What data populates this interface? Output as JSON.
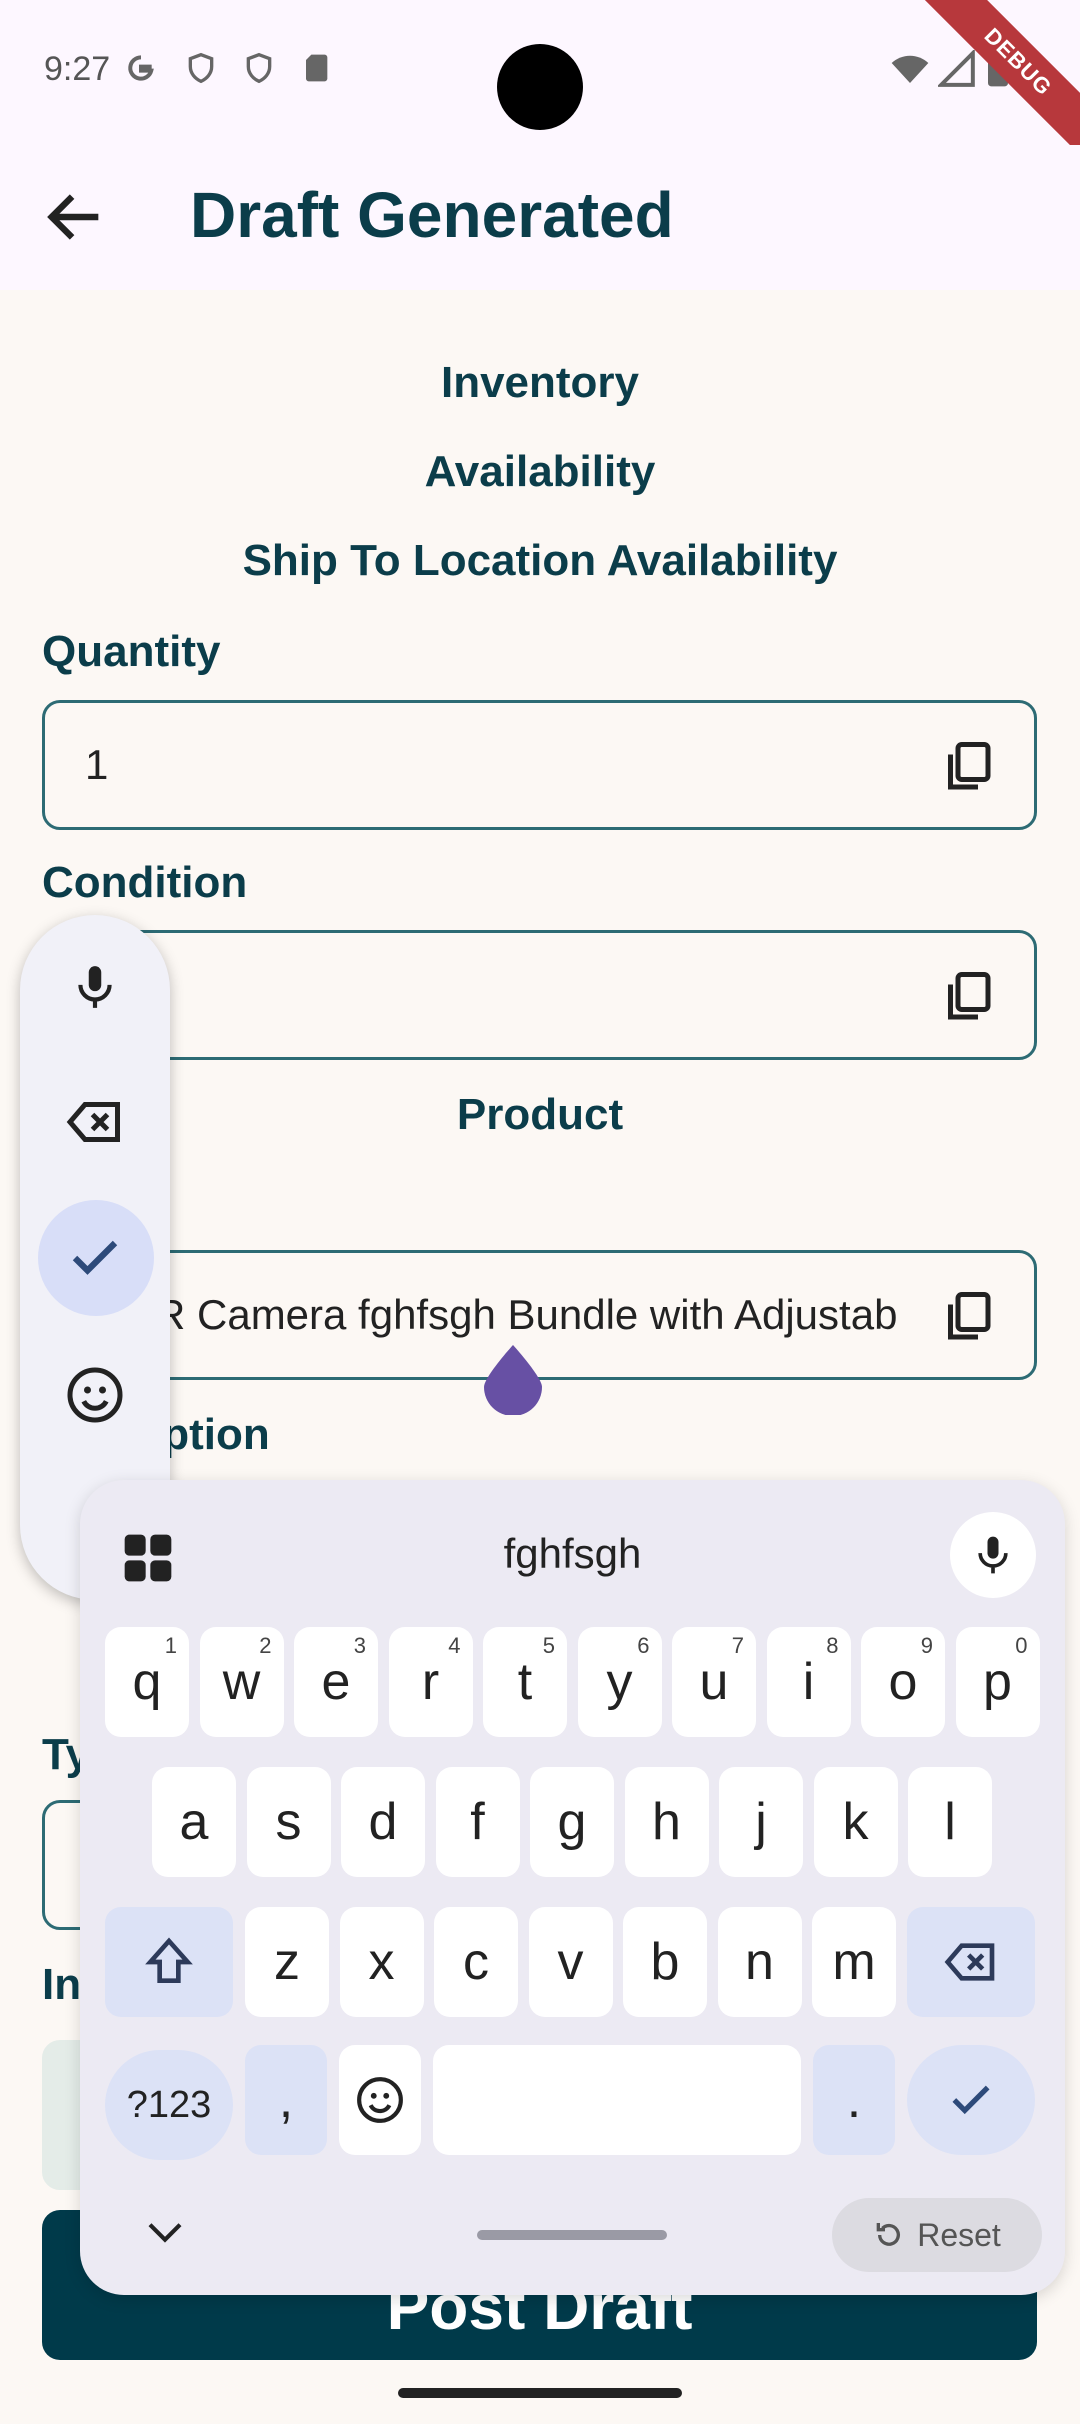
{
  "status": {
    "time": "9:27"
  },
  "debug_banner": "DEBUG",
  "appbar": {
    "title": "Draft Generated"
  },
  "sections": {
    "inventory": "Inventory",
    "availability": "Availability",
    "ship_to": "Ship To Location Availability",
    "product": "Product"
  },
  "fields": {
    "quantity_label": "Quantity",
    "quantity_value": "1",
    "condition_label": "Condition",
    "condition_value": "",
    "title_value": "R Camera fghfsgh Bundle with Adjustab",
    "description_label_partial": "iption",
    "type_label_partial": "Ty",
    "in_label_partial": "In"
  },
  "keyboard": {
    "suggestion": "fghfsgh",
    "row1": [
      {
        "k": "q",
        "h": "1"
      },
      {
        "k": "w",
        "h": "2"
      },
      {
        "k": "e",
        "h": "3"
      },
      {
        "k": "r",
        "h": "4"
      },
      {
        "k": "t",
        "h": "5"
      },
      {
        "k": "y",
        "h": "6"
      },
      {
        "k": "u",
        "h": "7"
      },
      {
        "k": "i",
        "h": "8"
      },
      {
        "k": "o",
        "h": "9"
      },
      {
        "k": "p",
        "h": "0"
      }
    ],
    "row2": [
      "a",
      "s",
      "d",
      "f",
      "g",
      "h",
      "j",
      "k",
      "l"
    ],
    "row3": [
      "z",
      "x",
      "c",
      "v",
      "b",
      "n",
      "m"
    ],
    "symbols_label": "?123",
    "comma": ",",
    "period": ".",
    "reset_label": "Reset"
  },
  "bottom_button": {
    "label": "Post Draft"
  },
  "colors": {
    "primary": "#0b3d4a",
    "accent_handle": "#6750a4",
    "debug": "#b7383c"
  }
}
